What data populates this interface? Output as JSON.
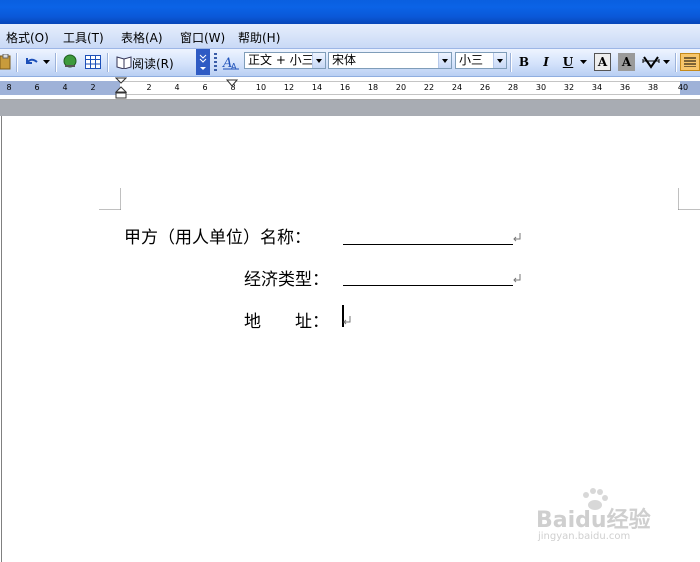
{
  "menubar": {
    "items": [
      "格式(O)",
      "工具(T)",
      "表格(A)",
      "窗口(W)",
      "帮助(H)"
    ]
  },
  "toolbar": {
    "read_label": "阅读(R)",
    "style_value": "正文 + 小三",
    "font_value": "宋体",
    "size_value": "小三",
    "bold_label": "B",
    "italic_label": "I",
    "underline_label": "U",
    "fontcolor_label": "A",
    "shade_label": "A"
  },
  "ruler": {
    "labels": [
      "8",
      "6",
      "4",
      "2",
      "2",
      "4",
      "6",
      "8",
      "10",
      "12",
      "14",
      "16",
      "18",
      "20",
      "22",
      "24",
      "26",
      "28",
      "30",
      "32",
      "34",
      "36",
      "38",
      "40"
    ]
  },
  "document": {
    "line1_label": "甲方（用人单位）名称：",
    "line2_label": "经济类型：",
    "line3_label": "地　　址："
  },
  "watermark": {
    "brand": "Baidu经验",
    "url": "jingyan.baidu.com"
  }
}
